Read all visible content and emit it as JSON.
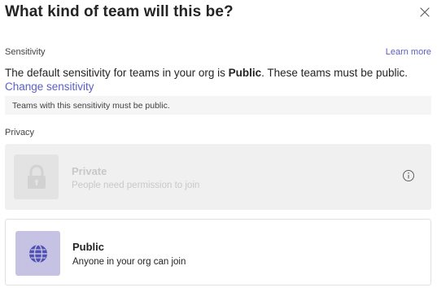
{
  "dialog": {
    "title": "What kind of team will this be?",
    "close_icon": "close-icon"
  },
  "sensitivity": {
    "label": "Sensitivity",
    "learn_more": "Learn more",
    "text_before": "The default sensitivity for teams in your org is ",
    "text_bold": "Public",
    "text_after": ". These teams must be public.",
    "change_link": "Change sensitivity",
    "notice": "Teams with this sensitivity must be public."
  },
  "privacy": {
    "label": "Privacy",
    "options": [
      {
        "title": "Private",
        "description": "People need permission to join",
        "icon": "lock-icon",
        "disabled": true,
        "info_icon": "info-icon"
      },
      {
        "title": "Public",
        "description": "Anyone in your org can join",
        "icon": "globe-icon",
        "disabled": false
      }
    ]
  },
  "colors": {
    "accent": "#5b5fc7",
    "public_tile": "#c5c2e3",
    "disabled_text": "#c8c8c8"
  }
}
